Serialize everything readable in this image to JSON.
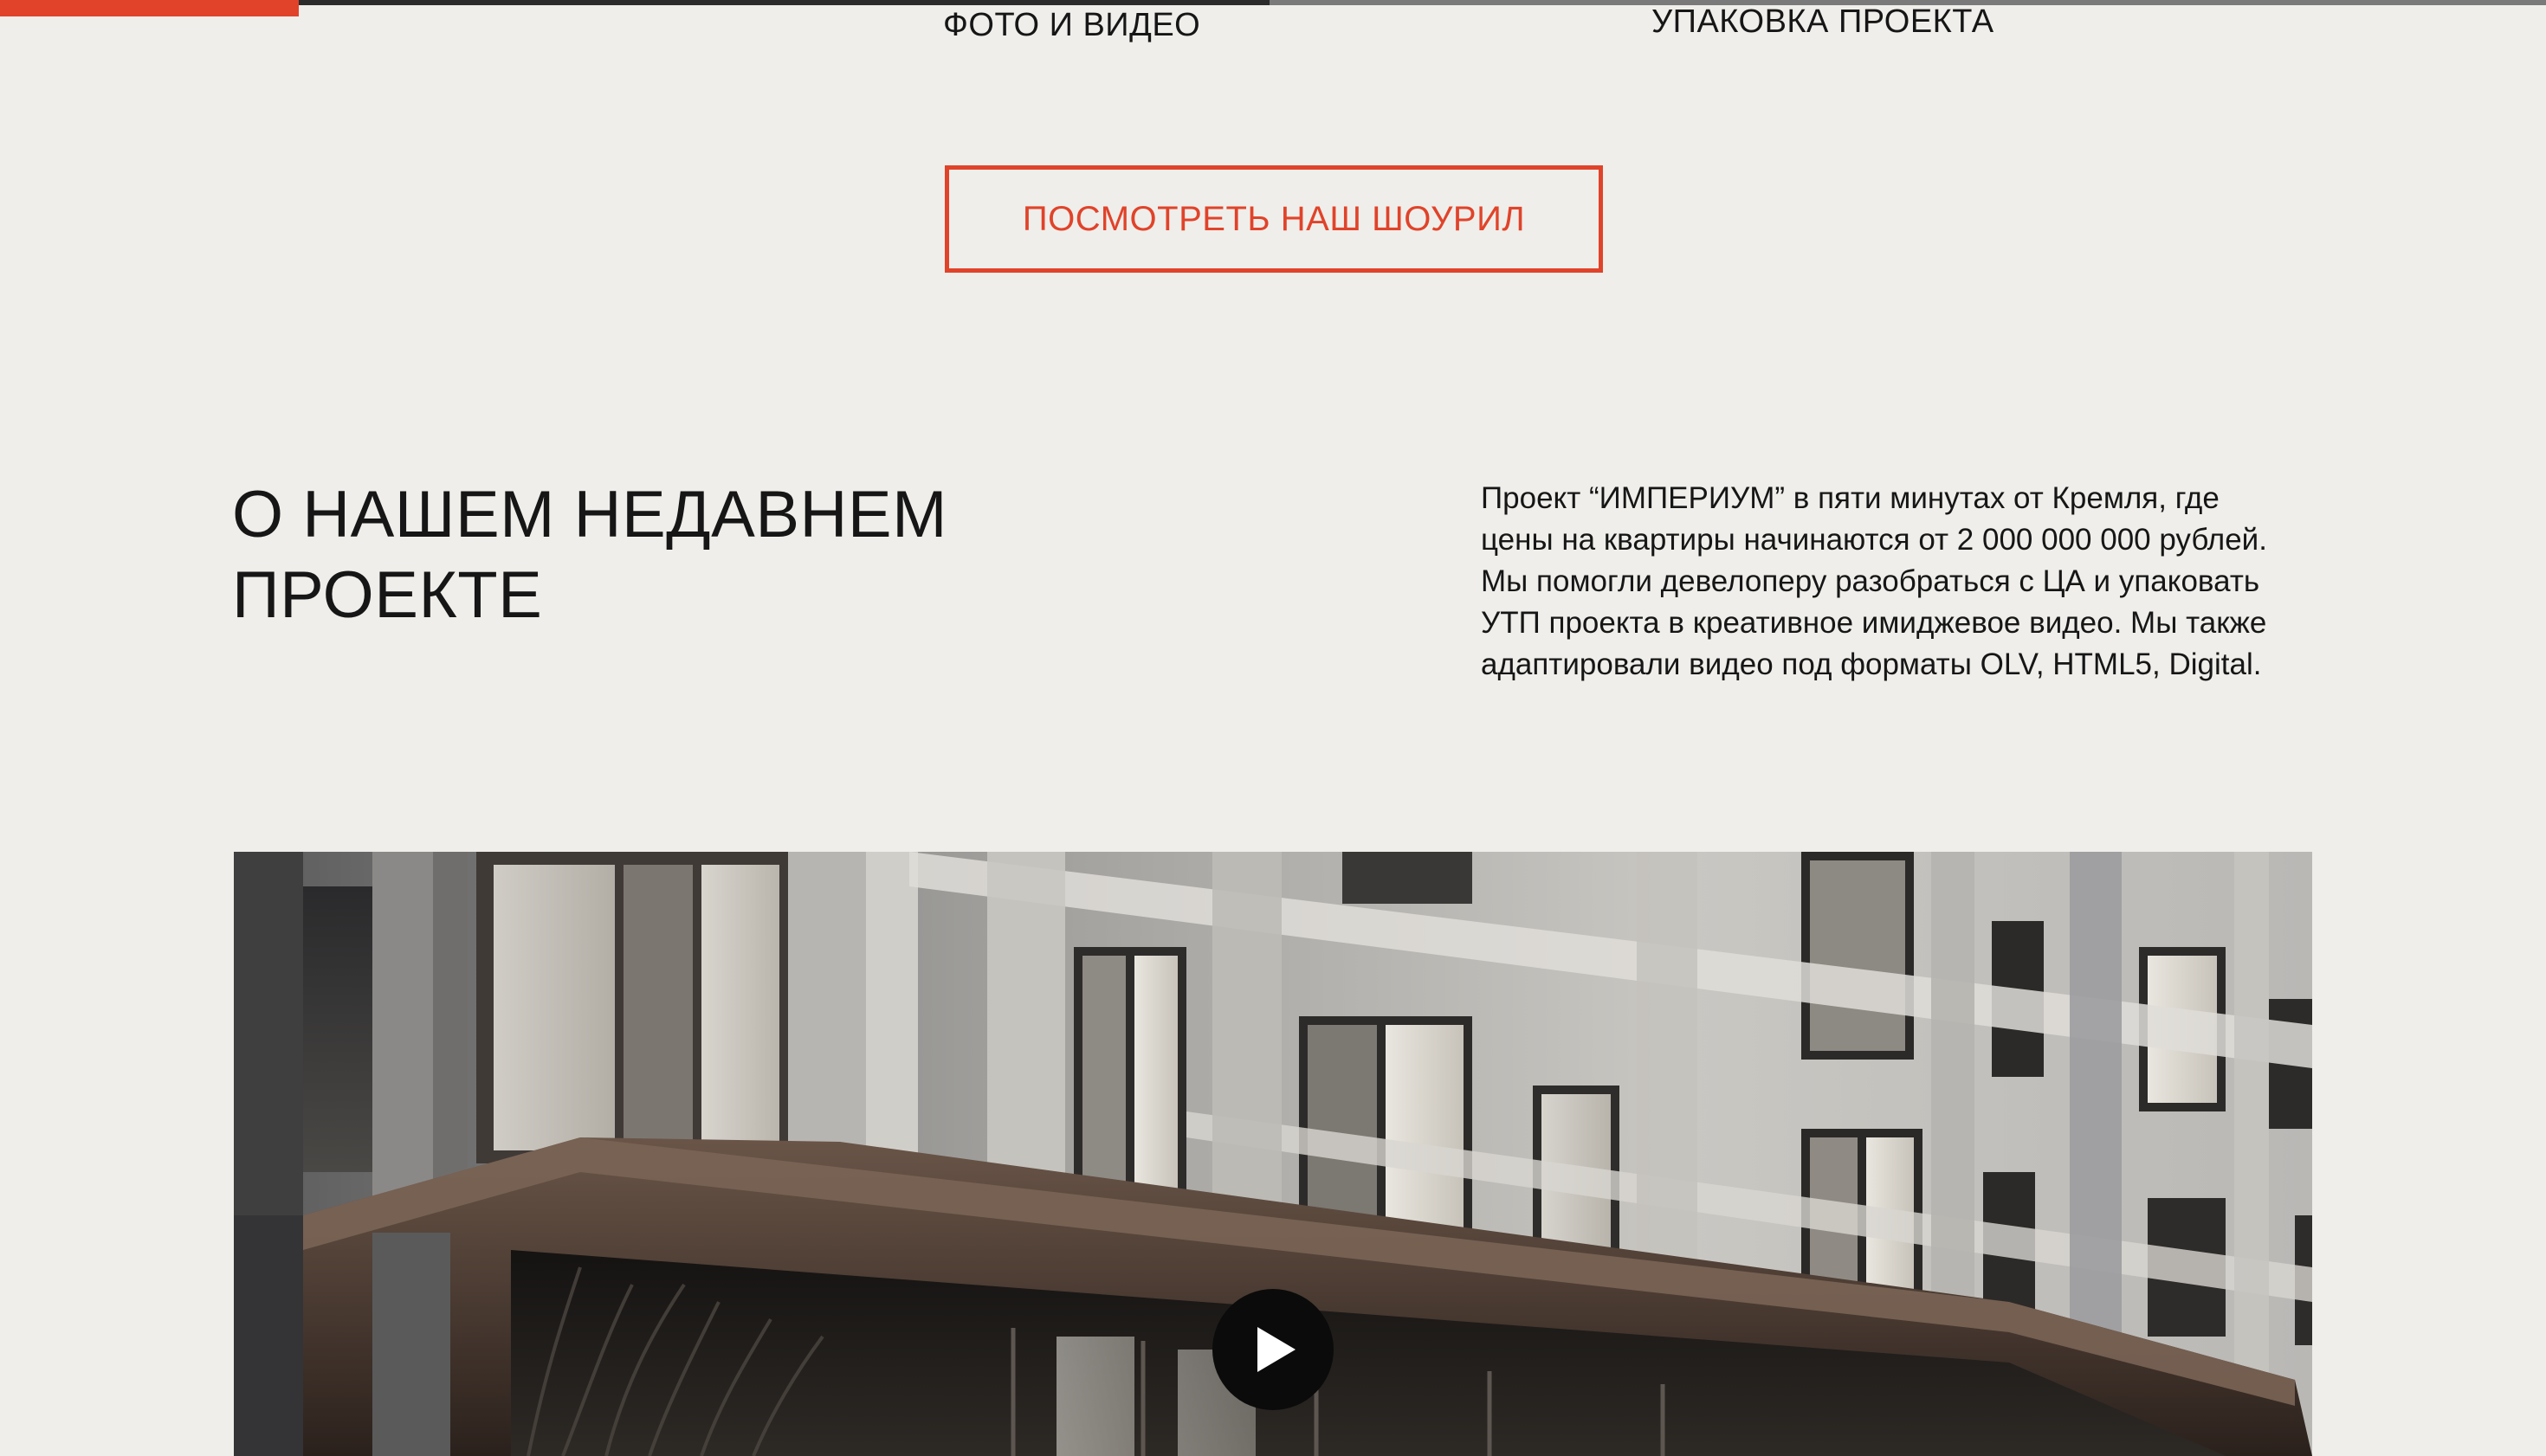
{
  "tabs": {
    "photo_video": "ФОТО И ВИДЕО",
    "packaging": "УПАКОВКА ПРОЕКТА"
  },
  "cta": {
    "label": "ПОСМОТРЕТЬ НАШ ШОУРИЛ"
  },
  "project": {
    "title_line1": "О НАШЕМ НЕДАВНЕМ",
    "title_line2": "ПРОЕКТЕ",
    "description": "Проект “ИМПЕРИУМ” в пяти минутах от Кремля, где цены на квартиры начинаются от 2 000 000 000 рублей. Мы помогли девелоперу разобраться с ЦА и упаковать УТП проекта в креативное имиджевое видео. Мы также адаптировали видео под форматы OLV, HTML5, Digital."
  },
  "media": {
    "play_icon": "play-icon"
  },
  "colors": {
    "accent": "#e0432a",
    "background": "#efeeea",
    "text": "#161616"
  }
}
